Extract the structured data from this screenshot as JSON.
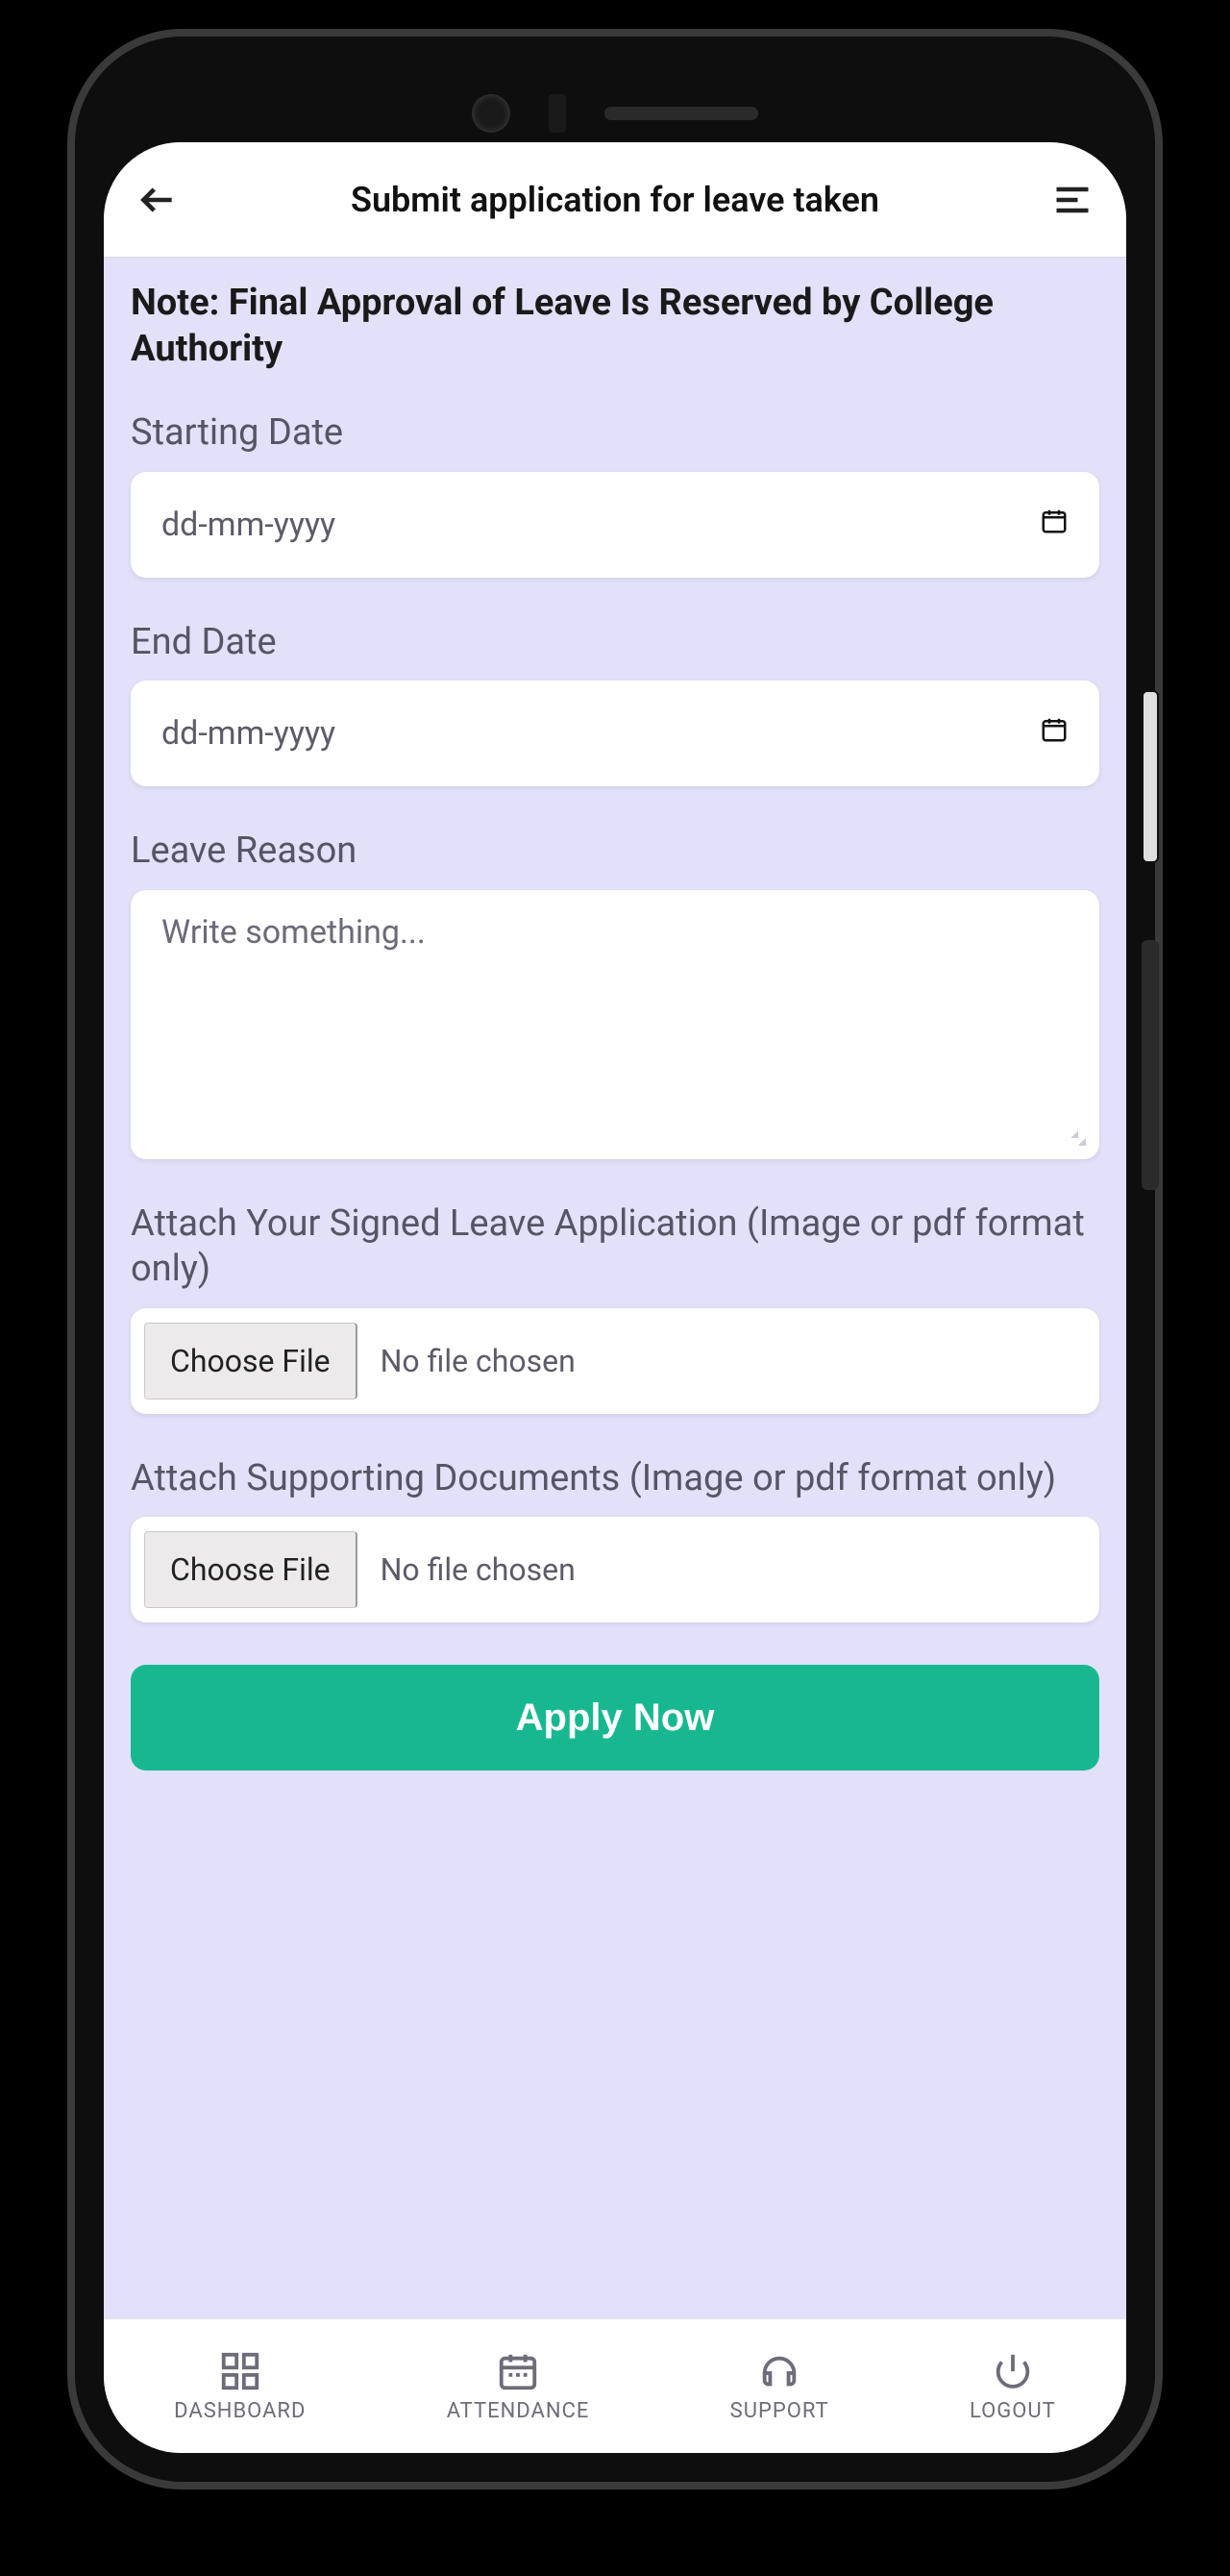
{
  "header": {
    "title": "Submit application for leave taken"
  },
  "note": "Note: Final Approval of Leave Is Reserved by College Authority",
  "fields": {
    "start": {
      "label": "Starting Date",
      "placeholder": "dd-mm-yyyy"
    },
    "end": {
      "label": "End Date",
      "placeholder": "dd-mm-yyyy"
    },
    "reason": {
      "label": "Leave Reason",
      "placeholder": "Write something..."
    },
    "file1": {
      "label": "Attach Your Signed Leave Application (Image or pdf format only)",
      "button": "Choose File",
      "status": "No file chosen"
    },
    "file2": {
      "label": "Attach Supporting Documents (Image or pdf format only)",
      "button": "Choose File",
      "status": "No file chosen"
    }
  },
  "submit_label": "Apply Now",
  "tabs": {
    "dashboard": "DASHBOARD",
    "attendance": "ATTENDANCE",
    "support": "SUPPORT",
    "logout": "LOGOUT"
  }
}
